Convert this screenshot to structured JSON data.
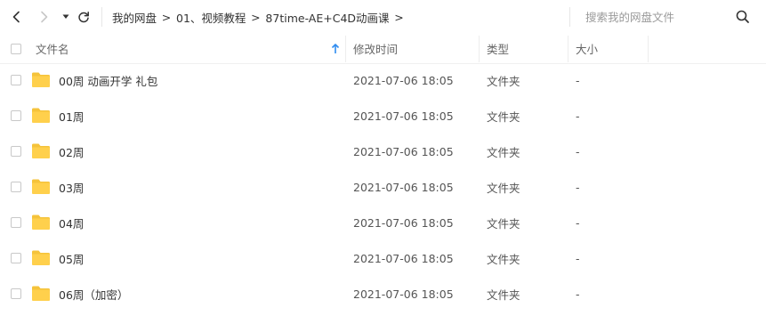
{
  "breadcrumb": {
    "items": [
      "我的网盘",
      "01、视频教程",
      "87time-AE+C4D动画课"
    ],
    "separator": ">"
  },
  "search": {
    "placeholder": "搜索我的网盘文件"
  },
  "columns": {
    "name": "文件名",
    "modified": "修改时间",
    "type": "类型",
    "size": "大小",
    "sort_indicator": "↑"
  },
  "files": [
    {
      "name": "00周 动画开学 礼包",
      "modified": "2021-07-06 18:05",
      "type": "文件夹",
      "size": "-"
    },
    {
      "name": "01周",
      "modified": "2021-07-06 18:05",
      "type": "文件夹",
      "size": "-"
    },
    {
      "name": "02周",
      "modified": "2021-07-06 18:05",
      "type": "文件夹",
      "size": "-"
    },
    {
      "name": "03周",
      "modified": "2021-07-06 18:05",
      "type": "文件夹",
      "size": "-"
    },
    {
      "name": "04周",
      "modified": "2021-07-06 18:05",
      "type": "文件夹",
      "size": "-"
    },
    {
      "name": "05周",
      "modified": "2021-07-06 18:05",
      "type": "文件夹",
      "size": "-"
    },
    {
      "name": "06周（加密）",
      "modified": "2021-07-06 18:05",
      "type": "文件夹",
      "size": "-"
    }
  ],
  "icons": {
    "back": "chevron-left-icon",
    "forward": "chevron-right-icon",
    "history": "caret-down-icon",
    "refresh": "refresh-icon",
    "search": "search-icon",
    "folder": "folder-icon"
  },
  "colors": {
    "folder": "#FFD04C",
    "sort_accent": "#2f8cf0",
    "divider": "#ededed"
  }
}
